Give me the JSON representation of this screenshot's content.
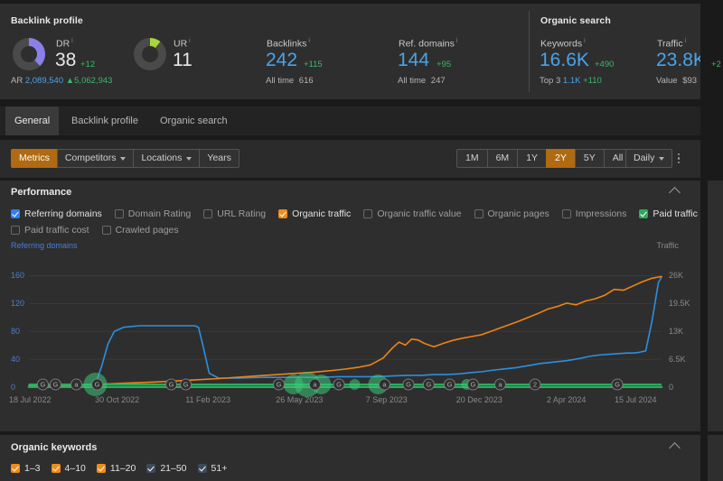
{
  "overview": {
    "backlink_profile": {
      "title": "Backlink profile",
      "dr": {
        "label": "DR",
        "value": "38",
        "delta": "+12",
        "arc_color": "#8b7fe8",
        "arc_pct": 38
      },
      "ur": {
        "label": "UR",
        "value": "11",
        "delta": "",
        "arc_color": "#a8d63a",
        "arc_pct": 11
      },
      "ar": {
        "label": "AR",
        "value": "2,089,540",
        "delta": "▲5,062,943"
      },
      "backlinks": {
        "label": "Backlinks",
        "value": "242",
        "delta": "+115",
        "sub_label": "All time",
        "sub_value": "616"
      },
      "ref_domains": {
        "label": "Ref. domains",
        "value": "144",
        "delta": "+95",
        "sub_label": "All time",
        "sub_value": "247"
      }
    },
    "organic_search": {
      "title": "Organic search",
      "keywords": {
        "label": "Keywords",
        "value": "16.6K",
        "delta": "+490",
        "sub_label": "Top 3",
        "sub_value": "1.1K",
        "sub_delta": "+110"
      },
      "traffic": {
        "label": "Traffic",
        "value": "23.8K",
        "delta": "+2",
        "sub_label": "Value",
        "sub_value": "$93"
      }
    }
  },
  "tabs": [
    {
      "label": "General",
      "active": true
    },
    {
      "label": "Backlink profile",
      "active": false
    },
    {
      "label": "Organic search",
      "active": false
    }
  ],
  "toolbar": {
    "left_buttons": [
      {
        "label": "Metrics",
        "active": true,
        "caret": false
      },
      {
        "label": "Competitors",
        "active": false,
        "caret": true
      },
      {
        "label": "Locations",
        "active": false,
        "caret": true
      },
      {
        "label": "Years",
        "active": false,
        "caret": false
      }
    ],
    "ranges": [
      {
        "label": "1M",
        "active": false
      },
      {
        "label": "6M",
        "active": false
      },
      {
        "label": "1Y",
        "active": false
      },
      {
        "label": "2Y",
        "active": true
      },
      {
        "label": "5Y",
        "active": false
      },
      {
        "label": "All",
        "active": false
      }
    ],
    "granularity": {
      "label": "Daily",
      "caret": true
    },
    "more_menu": "kebab-menu"
  },
  "performance": {
    "title": "Performance",
    "checkboxes": [
      {
        "label": "Referring domains",
        "checked": true,
        "color": "#2d7ff9"
      },
      {
        "label": "Domain Rating",
        "checked": false,
        "color": ""
      },
      {
        "label": "URL Rating",
        "checked": false,
        "color": ""
      },
      {
        "label": "Organic traffic",
        "checked": true,
        "color": "#f08c1a"
      },
      {
        "label": "Organic traffic value",
        "checked": false,
        "color": ""
      },
      {
        "label": "Organic pages",
        "checked": false,
        "color": ""
      },
      {
        "label": "Impressions",
        "checked": false,
        "color": ""
      },
      {
        "label": "Paid traffic",
        "checked": true,
        "color": "#2aab5e"
      },
      {
        "label": "Paid traffic cost",
        "checked": false,
        "color": ""
      },
      {
        "label": "Crawled pages",
        "checked": false,
        "color": ""
      }
    ]
  },
  "organic_keywords": {
    "title": "Organic keywords",
    "checkboxes": [
      {
        "label": "1–3",
        "checked": true,
        "color": "#f08c1a"
      },
      {
        "label": "4–10",
        "checked": true,
        "color": "#f08c1a"
      },
      {
        "label": "11–20",
        "checked": true,
        "color": "#f08c1a"
      },
      {
        "label": "21–50",
        "checked": true,
        "color": "#3c4a5a"
      },
      {
        "label": "51+",
        "checked": true,
        "color": "#3c4a5a"
      }
    ]
  },
  "chart_data": {
    "type": "line",
    "title": "Performance",
    "xlabel": "",
    "ylabel": "Referring domains",
    "y2label": "Traffic",
    "grid": true,
    "legend": "none",
    "ylim": [
      0,
      180
    ],
    "y2lim": [
      0,
      29250
    ],
    "yticks": [
      "0",
      "40",
      "80",
      "120",
      "160"
    ],
    "ytick_values": [
      0,
      40,
      80,
      120,
      160
    ],
    "y2ticks": [
      "0",
      "6.5K",
      "13K",
      "19.5K",
      "26K"
    ],
    "y2tick_values": [
      0,
      6500,
      13000,
      19500,
      26000
    ],
    "xticks": [
      "18 Jul 2022",
      "30 Oct 2022",
      "11 Feb 2023",
      "26 May 2023",
      "7 Sep 2023",
      "20 Dec 2023",
      "2 Apr 2024",
      "15 Jul 2024"
    ],
    "xtick_positions": [
      0,
      0.143,
      0.286,
      0.429,
      0.571,
      0.714,
      0.857,
      1.0
    ],
    "series": [
      {
        "name": "Referring domains",
        "color": "#2d8fe0",
        "axis": "left",
        "x": [
          0,
          0.04,
          0.085,
          0.105,
          0.115,
          0.125,
          0.135,
          0.15,
          0.175,
          0.2,
          0.225,
          0.25,
          0.262,
          0.268,
          0.275,
          0.285,
          0.3,
          0.33,
          0.37,
          0.4,
          0.43,
          0.46,
          0.49,
          0.52,
          0.55,
          0.575,
          0.6,
          0.62,
          0.64,
          0.66,
          0.68,
          0.7,
          0.715,
          0.73,
          0.75,
          0.77,
          0.79,
          0.81,
          0.83,
          0.85,
          0.87,
          0.885,
          0.9,
          0.915,
          0.93,
          0.945,
          0.955,
          0.965,
          0.975,
          0.985,
          0.995,
          1.0
        ],
        "y": [
          3,
          3,
          3,
          4,
          30,
          62,
          80,
          86,
          88,
          88,
          88,
          88,
          88,
          86,
          60,
          20,
          13,
          13,
          14,
          14,
          14,
          14,
          15,
          15,
          15,
          16,
          17,
          17,
          18,
          18,
          19,
          21,
          22,
          24,
          26,
          28,
          31,
          34,
          36,
          38,
          41,
          44,
          46,
          47,
          48,
          49,
          49,
          50,
          52,
          95,
          150,
          158
        ]
      },
      {
        "name": "Organic traffic",
        "color": "#ef8413",
        "axis": "right",
        "x": [
          0,
          0.05,
          0.1,
          0.15,
          0.2,
          0.25,
          0.3,
          0.33,
          0.36,
          0.39,
          0.42,
          0.45,
          0.48,
          0.5,
          0.52,
          0.54,
          0.56,
          0.575,
          0.585,
          0.595,
          0.605,
          0.615,
          0.625,
          0.64,
          0.655,
          0.67,
          0.685,
          0.7,
          0.715,
          0.73,
          0.745,
          0.76,
          0.775,
          0.79,
          0.805,
          0.82,
          0.835,
          0.85,
          0.865,
          0.88,
          0.895,
          0.91,
          0.925,
          0.94,
          0.955,
          0.97,
          0.985,
          1.0
        ],
        "y": [
          300,
          400,
          600,
          900,
          1200,
          1600,
          2000,
          2300,
          2600,
          2900,
          3200,
          3500,
          3900,
          4200,
          4600,
          5200,
          6800,
          9200,
          10500,
          9800,
          11200,
          11000,
          10200,
          9400,
          10200,
          10900,
          11400,
          11800,
          12200,
          13000,
          13800,
          14600,
          15400,
          16300,
          17200,
          18200,
          18800,
          19600,
          19200,
          20100,
          20600,
          21400,
          22800,
          22600,
          23600,
          24600,
          25400,
          25800
        ]
      },
      {
        "name": "Paid traffic",
        "color": "#2aab5e",
        "axis": "right",
        "x": [
          0,
          0.25,
          0.5,
          0.75,
          1.0
        ],
        "y": [
          60,
          60,
          60,
          60,
          60
        ]
      }
    ],
    "annotations": [
      {
        "label": "G",
        "x": 0.022
      },
      {
        "label": "G",
        "x": 0.042
      },
      {
        "label": "a",
        "x": 0.075
      },
      {
        "label": "G",
        "x": 0.108
      },
      {
        "label": "G",
        "x": 0.225
      },
      {
        "label": "G",
        "x": 0.248
      },
      {
        "label": "G",
        "x": 0.395
      },
      {
        "label": "a",
        "x": 0.452
      },
      {
        "label": "G",
        "x": 0.49
      },
      {
        "label": "a",
        "x": 0.562
      },
      {
        "label": "G",
        "x": 0.6
      },
      {
        "label": "G",
        "x": 0.632
      },
      {
        "label": "G",
        "x": 0.665
      },
      {
        "label": "G",
        "x": 0.702
      },
      {
        "label": "a",
        "x": 0.745
      },
      {
        "label": "2",
        "x": 0.8
      },
      {
        "label": "G",
        "x": 0.93
      }
    ],
    "event_blobs": [
      {
        "x": 0.105,
        "r": 13
      },
      {
        "x": 0.418,
        "r": 11
      },
      {
        "x": 0.44,
        "r": 14
      },
      {
        "x": 0.462,
        "r": 11
      },
      {
        "x": 0.515,
        "r": 6
      },
      {
        "x": 0.552,
        "r": 11
      },
      {
        "x": 0.692,
        "r": 6
      }
    ]
  }
}
